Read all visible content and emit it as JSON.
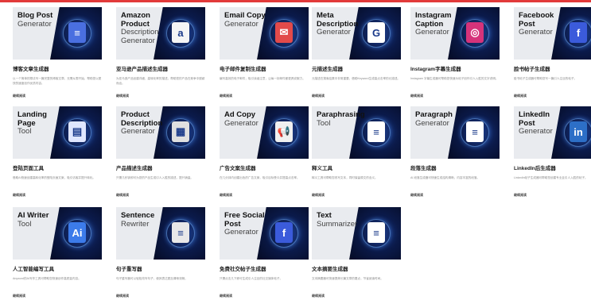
{
  "cards": [
    {
      "title": "Blog Post",
      "subtitle": "Generator",
      "name": "博客文章生成器",
      "desc": "以一个简单的想法写一篇完整的博客文章。无需从零开始，帮助您以更快的速度创作优质内容。",
      "link": "继续阅读",
      "icon": "document-icon",
      "accent": "#4a6fe0"
    },
    {
      "title": "Amazon Product",
      "subtitle": "Description Generator",
      "name": "亚马逊产品描述生成器",
      "desc": "为亚马逊产品创建详细、高转化率的描述，帮助您的产品在竞争中脱颖而出。",
      "link": "继续阅读",
      "icon": "amazon-icon",
      "accent": "#f5f5f5"
    },
    {
      "title": "Email Copy",
      "subtitle": "Generator",
      "name": "电子邮件复制生成器",
      "desc": "编写高效的电子邮件，吸引读者注意，让每一封邮件都更具说服力。",
      "link": "继续阅读",
      "icon": "mail-icon",
      "accent": "#e24a4a"
    },
    {
      "title": "Meta Description",
      "subtitle": "Generator",
      "name": "元描述生成器",
      "desc": "元描述在搜索结果中非常重要，借助Keyword生成高点击率的元描述。",
      "link": "继续阅读",
      "icon": "google-icon",
      "accent": "#ffffff"
    },
    {
      "title": "Instagram Caption",
      "subtitle": "Generator",
      "name": "Instagram字幕生成器",
      "desc": "Instagram 字幕生成器可帮助您快速为帖子创作引人入胜的文字说明。",
      "link": "继续阅读",
      "icon": "instagram-icon",
      "accent": "#d6337a"
    },
    {
      "title": "Facebook Post",
      "subtitle": "Generator",
      "name": "脸书帖子生成器",
      "desc": "脸书帖子生成器可帮助您写一篇引人注目的帖子。",
      "link": "继续阅读",
      "icon": "facebook-icon",
      "accent": "#3b5bdb"
    },
    {
      "title": "Landing Page",
      "subtitle": "Tool",
      "name": "登陆页面工具",
      "desc": "借助AI快速创建高转化率的登陆页面文案，吸引访客并提升转化。",
      "link": "继续阅读",
      "icon": "page-icon",
      "accent": "#dfe6ff"
    },
    {
      "title": "Product Description",
      "subtitle": "Generator",
      "name": "产品描述生成器",
      "desc": "只需几秒钟即可为您的产品生成引人入胜的描述，提升销量。",
      "link": "继续阅读",
      "icon": "product-icon",
      "accent": "#e0e0e0"
    },
    {
      "title": "Ad Copy",
      "subtitle": "Generator",
      "name": "广告文案生成器",
      "desc": "在几分钟内创建出色的广告文案，吸引目标受众并提高点击率。",
      "link": "继续阅读",
      "icon": "megaphone-icon",
      "accent": "#f0f0f0"
    },
    {
      "title": "Paraphrasing",
      "subtitle": "Tool",
      "name": "释义工具",
      "desc": "释义工具可帮助您改写文本，同时保留原文的含义。",
      "link": "继续阅读",
      "icon": "document-icon",
      "accent": "#ffffff"
    },
    {
      "title": "Paragraph",
      "subtitle": "Generator",
      "name": "段落生成器",
      "desc": "AI 段落生成器可快速生成结构清晰、内容丰富的段落。",
      "link": "继续阅读",
      "icon": "document-icon",
      "accent": "#ffffff"
    },
    {
      "title": "LinkedIn Post",
      "subtitle": "Generator",
      "name": "LinkedIn后生成器",
      "desc": "LinkedIn帖子生成器可帮助您创建专业且引人入胜的帖子。",
      "link": "继续阅读",
      "icon": "linkedin-icon",
      "accent": "#2d6fc7"
    },
    {
      "title": "AI Writer",
      "subtitle": "Tool",
      "name": "人工智能编写工具",
      "desc": "Anyword的AI写作工具可帮助您快速创作高质量内容。",
      "link": "继续阅读",
      "icon": "ai-icon",
      "accent": "#3c7bea"
    },
    {
      "title": "Sentence",
      "subtitle": "Rewriter",
      "name": "句子重写器",
      "desc": "句子重写器可以轻松改写句子，使其表达更加清晰流畅。",
      "link": "继续阅读",
      "icon": "sentence-icon",
      "accent": "#e8e8e8"
    },
    {
      "title": "Free Social Post",
      "subtitle": "Generator",
      "name": "免费社交帖子生成器",
      "desc": "只需点击几下即可生成引人注目的社交媒体帖子。",
      "link": "继续阅读",
      "icon": "social-icon",
      "accent": "#3b5bdb"
    },
    {
      "title": "Text",
      "subtitle": "Summarizer",
      "name": "文本摘要生成器",
      "desc": "文本摘要器可快速提炼长篇文章的要点，节省阅读时间。",
      "link": "继续阅读",
      "icon": "summary-icon",
      "accent": "#ffffff"
    }
  ],
  "icon_glyphs": {
    "document-icon": "≡",
    "amazon-icon": "a",
    "mail-icon": "✉",
    "google-icon": "G",
    "instagram-icon": "◎",
    "facebook-icon": "f",
    "page-icon": "▤",
    "product-icon": "▦",
    "megaphone-icon": "📢",
    "linkedin-icon": "in",
    "ai-icon": "Ai",
    "sentence-icon": "≡",
    "social-icon": "f",
    "summary-icon": "≡"
  }
}
